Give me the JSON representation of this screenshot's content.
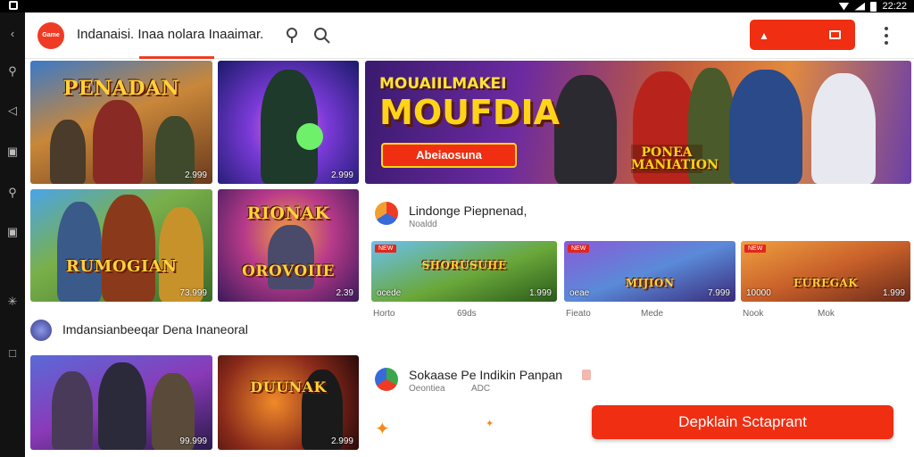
{
  "status_bar": {
    "time": "22:22"
  },
  "sidebar": {
    "items": [
      "back-icon",
      "search-icon",
      "share-icon",
      "library-icon",
      "search-icon",
      "library-icon",
      "settings-icon",
      "square-icon"
    ]
  },
  "header": {
    "logo_text": "Game",
    "title": "Indanaisi. Inaa nolara Inaaimar.",
    "accent": "#ef2e12"
  },
  "top_row": [
    {
      "title": "PENADAN",
      "size": "2.999"
    },
    {
      "title": "",
      "size": "2.999"
    }
  ],
  "hero": {
    "subtitle": "MOUAIILMAKEI",
    "title": "MOUFDIA",
    "banner": "Abeiaosuna",
    "logo": "PONEA MANIATION"
  },
  "second_row": [
    {
      "title": "RUMOGIAN",
      "size": "73.999"
    },
    {
      "title": "RIONAK",
      "title2": "OROVOIIE",
      "size": "2.39"
    }
  ],
  "section1": {
    "title": "Lindonge Piepnenad,",
    "subtitle": "Noaldd",
    "cards": [
      {
        "badge": "NEW",
        "title": "SHORUSUHE",
        "left": "ocede",
        "size": "1.999",
        "meta_left": "Horto",
        "meta_right": "69ds"
      },
      {
        "badge": "NEW",
        "title": "MIJION",
        "left": "oeae",
        "size": "7.999",
        "meta_left": "Fieato",
        "meta_right": "Mede"
      },
      {
        "badge": "NEW",
        "title": "EUREGAK",
        "left": "10000",
        "size": "1.999",
        "meta_left": "Nook",
        "meta_right": "Mok"
      }
    ]
  },
  "section2": {
    "title": "Imdansianbeeqar Dena Inaneoral"
  },
  "bottom_row": [
    {
      "title": "",
      "size": "99.999"
    },
    {
      "title": "DUUNAK",
      "size": "2.999"
    }
  ],
  "section3": {
    "title": "Sokaase Pe Indikin Panpan",
    "subtitle": "Oeontiea",
    "meta": "ADC"
  },
  "cta": {
    "label": "Depklain Sctaprant"
  }
}
